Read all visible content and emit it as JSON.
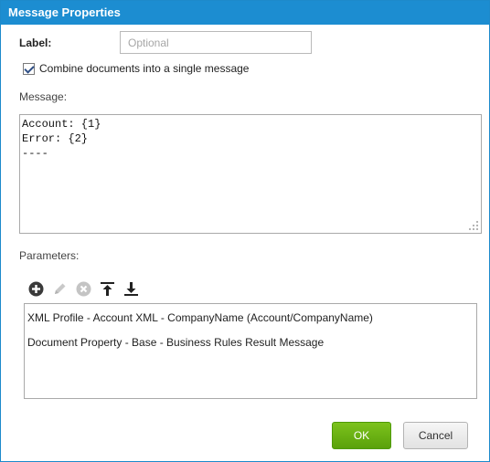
{
  "dialog": {
    "title": "Message Properties"
  },
  "label_field": {
    "label": "Label:",
    "value": "",
    "placeholder": "Optional"
  },
  "combine": {
    "checked": true,
    "label": "Combine documents into a single message"
  },
  "message": {
    "label": "Message:",
    "text": "Account: {1}\nError: {2}\n----"
  },
  "parameters": {
    "label": "Parameters:",
    "toolbar": {
      "icons": [
        "add-icon",
        "edit-icon",
        "delete-icon",
        "move-up-icon",
        "move-down-icon"
      ]
    },
    "items": [
      "XML Profile - Account XML - CompanyName (Account/CompanyName)",
      "Document Property - Base - Business Rules Result Message"
    ]
  },
  "buttons": {
    "ok": "OK",
    "cancel": "Cancel"
  },
  "colors": {
    "titlebar": "#1c8dd1",
    "ok_button": "#6bb414"
  }
}
